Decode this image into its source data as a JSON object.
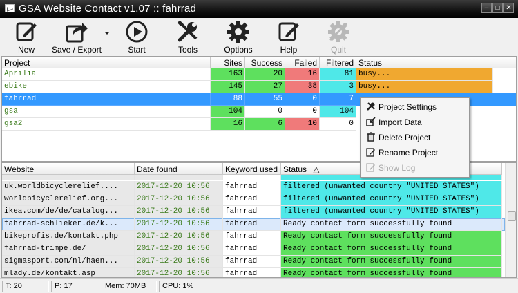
{
  "window": {
    "title": "GSA Website Contact v1.07 :: fahrrad"
  },
  "toolbar": {
    "new": "New",
    "save_export": "Save / Export",
    "start": "Start",
    "tools": "Tools",
    "options": "Options",
    "help": "Help",
    "quit": "Quit"
  },
  "projects": {
    "headers": {
      "project": "Project",
      "sites": "Sites",
      "success": "Success",
      "failed": "Failed",
      "filtered": "Filtered",
      "status": "Status"
    },
    "rows": [
      {
        "project": "Aprilia",
        "sites": "163",
        "success": "20",
        "failed": "16",
        "filtered": "81",
        "status": "busy..."
      },
      {
        "project": "ebike",
        "sites": "145",
        "success": "27",
        "failed": "38",
        "filtered": "3",
        "status": "busy..."
      },
      {
        "project": "fahrrad",
        "sites": "88",
        "success": "55",
        "failed": "0",
        "filtered": "7",
        "status": ""
      },
      {
        "project": "gsa",
        "sites": "104",
        "success": "0",
        "failed": "0",
        "filtered": "104",
        "status": ""
      },
      {
        "project": "gsa2",
        "sites": "16",
        "success": "6",
        "failed": "10",
        "filtered": "0",
        "status": ""
      }
    ]
  },
  "context_menu": {
    "project_settings": "Project Settings",
    "import_data": "Import Data",
    "delete_project": "Delete Project",
    "rename_project": "Rename Project",
    "show_log": "Show Log"
  },
  "log": {
    "headers": {
      "website": "Website",
      "date_found": "Date found",
      "keyword_used": "Keyword used",
      "status": "Status"
    },
    "rows": [
      {
        "website": "uk.worldbicyclerelief....",
        "date": "2017-12-20 10:56",
        "keyword": "fahrrad",
        "status": "filtered (unwanted country \"UNITED STATES\")"
      },
      {
        "website": "worldbicyclerelief.org...",
        "date": "2017-12-20 10:56",
        "keyword": "fahrrad",
        "status": "filtered (unwanted country \"UNITED STATES\")"
      },
      {
        "website": "ikea.com/de/de/catalog...",
        "date": "2017-12-20 10:56",
        "keyword": "fahrrad",
        "status": "filtered (unwanted country \"UNITED STATES\")"
      },
      {
        "website": "fahrrad-schlieker.de/k...",
        "date": "2017-12-20 10:56",
        "keyword": "fahrrad",
        "status": "Ready contact form successfully found"
      },
      {
        "website": "bikeprofis.de/kontakt.php",
        "date": "2017-12-20 10:56",
        "keyword": "fahrrad",
        "status": "Ready contact form successfully found"
      },
      {
        "website": "fahrrad-trimpe.de/",
        "date": "2017-12-20 10:56",
        "keyword": "fahrrad",
        "status": "Ready contact form successfully found"
      },
      {
        "website": "sigmasport.com/nl/haen...",
        "date": "2017-12-20 10:56",
        "keyword": "fahrrad",
        "status": "Ready contact form successfully found"
      },
      {
        "website": "mlady.de/kontakt.asp",
        "date": "2017-12-20 10:56",
        "keyword": "fahrrad",
        "status": "Ready contact form successfully found"
      }
    ]
  },
  "statusbar": {
    "threads": "T: 20",
    "projects": "P: 17",
    "memory": "Mem: 70MB",
    "cpu": "CPU: 1%"
  },
  "colors": {
    "green": "#5ee05e",
    "red": "#f07a7a",
    "cyan": "#4fe8e8",
    "orange": "#f0a830",
    "selection": "#3399ff"
  }
}
